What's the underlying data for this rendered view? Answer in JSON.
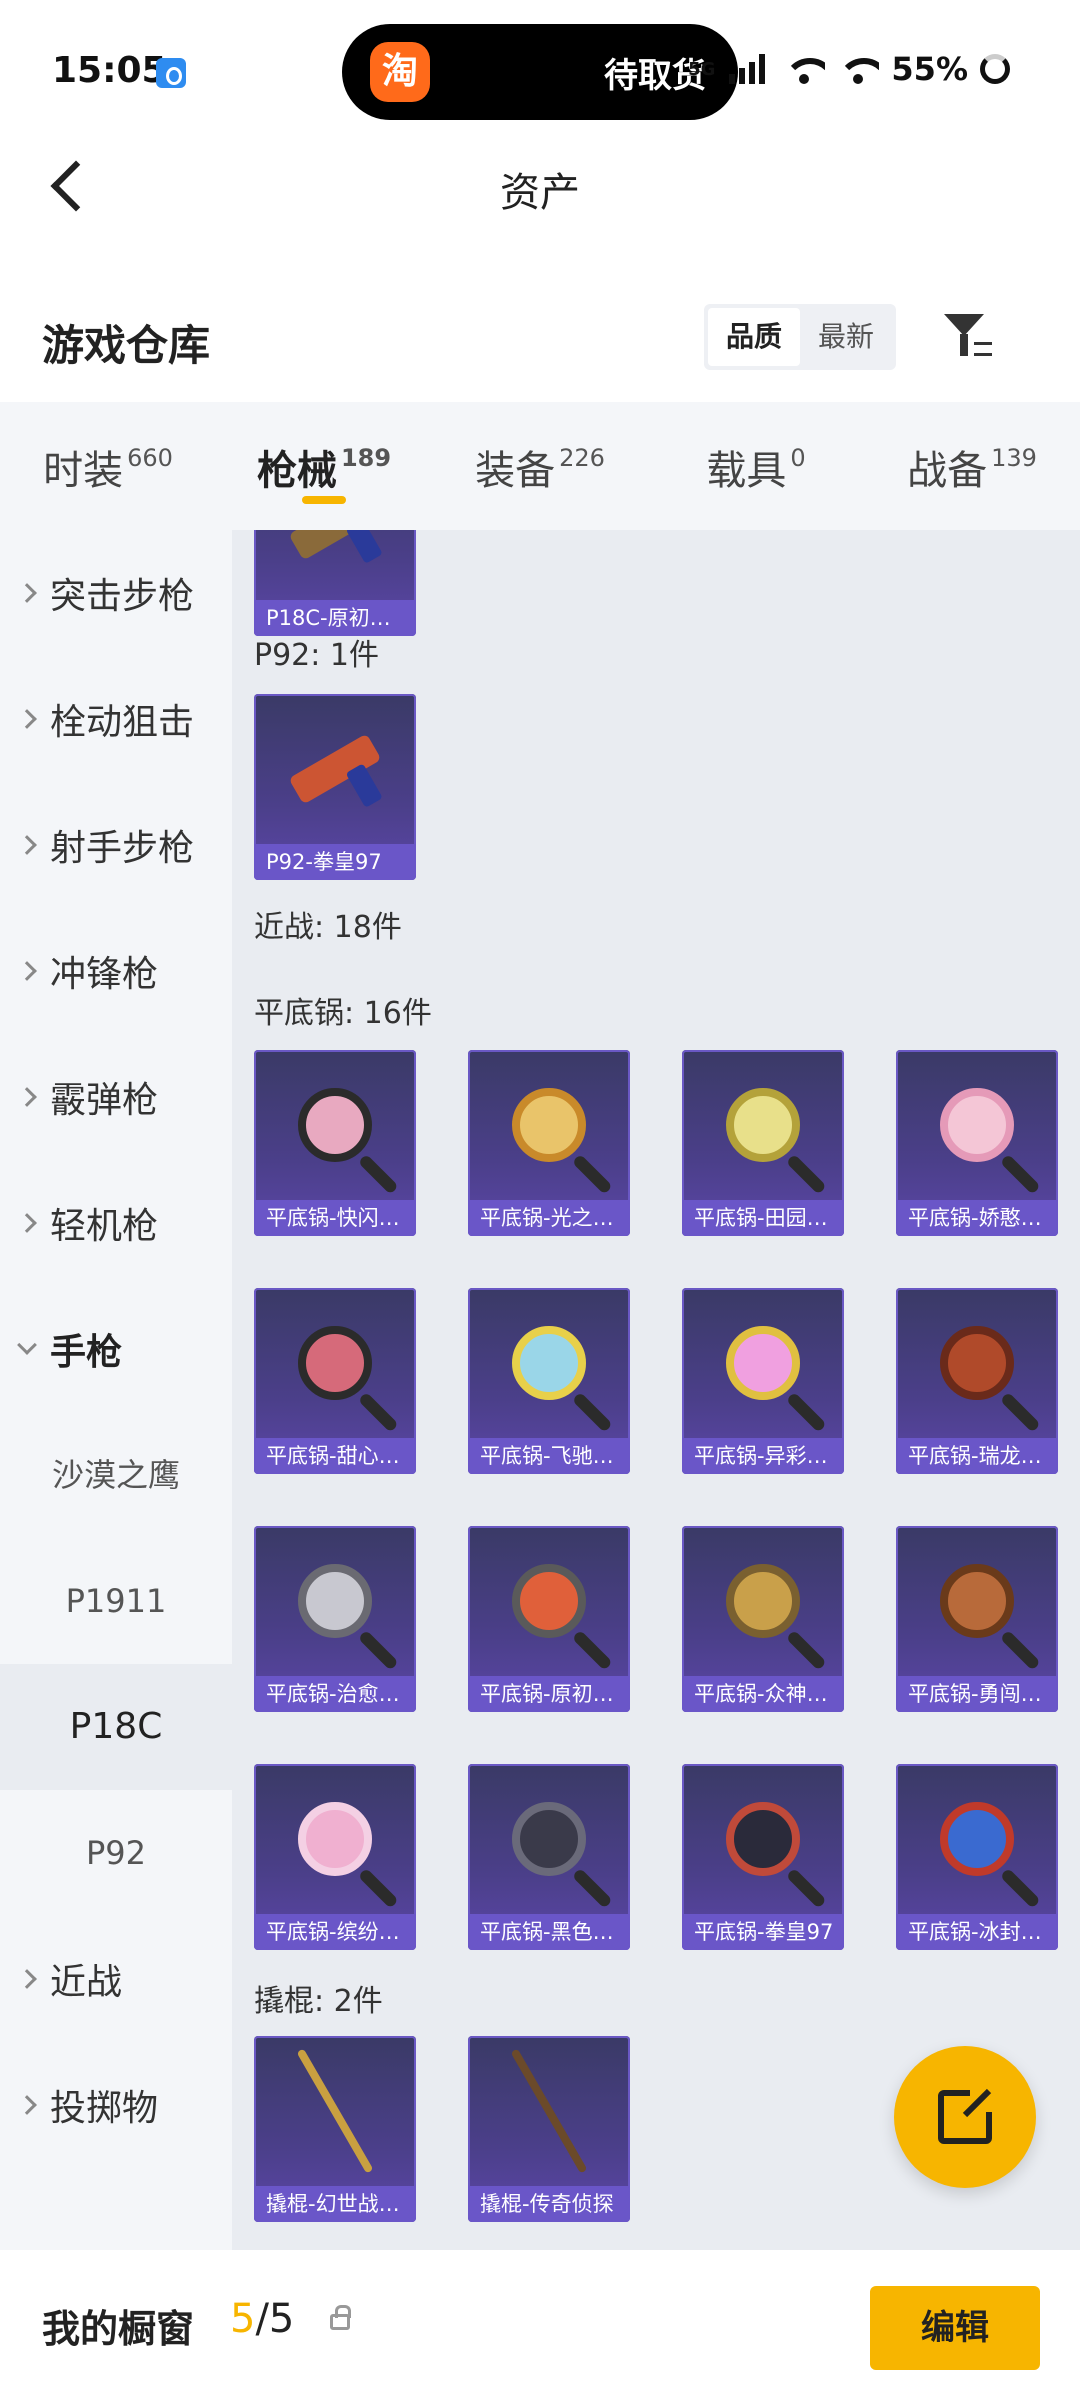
{
  "status_bar": {
    "time": "15:05",
    "pill_app_glyph": "淘",
    "pill_text": "待取货",
    "battery": "55%",
    "signal": "5G"
  },
  "header": {
    "title": "资产"
  },
  "warehouse": {
    "title": "游戏仓库",
    "sort_options": [
      "品质",
      "最新"
    ]
  },
  "tabs": [
    {
      "label": "时装",
      "count": "660"
    },
    {
      "label": "枪械",
      "count": "189"
    },
    {
      "label": "装备",
      "count": "226"
    },
    {
      "label": "载具",
      "count": "0"
    },
    {
      "label": "战备",
      "count": "139"
    }
  ],
  "sidebar": {
    "items": [
      "突击步枪",
      "栓动狙击",
      "射手步枪",
      "冲锋枪",
      "霰弹枪",
      "轻机枪",
      "手枪"
    ],
    "pistol_subs": [
      "沙漠之鹰",
      "P1911",
      "P18C",
      "P92"
    ],
    "after_items": [
      "近战",
      "投掷物"
    ]
  },
  "content": {
    "top_card_label": "P18C-原初…",
    "p92_header": "P92: 1件",
    "p92_card_label": "P92-拳皇97",
    "melee_header": "近战: 18件",
    "pan_header": "平底锅: 16件",
    "pan_cards": [
      "平底锅-快闪…",
      "平底锅-光之…",
      "平底锅-田园…",
      "平底锅-娇憨…",
      "平底锅-甜心…",
      "平底锅-飞驰…",
      "平底锅-异彩…",
      "平底锅-瑞龙…",
      "平底锅-治愈…",
      "平底锅-原初…",
      "平底锅-众神…",
      "平底锅-勇闯…",
      "平底锅-缤纷…",
      "平底锅-黑色…",
      "平底锅-拳皇97",
      "平底锅-冰封…"
    ],
    "crowbar_header": "撬棍: 2件",
    "crowbar_cards": [
      "撬棍-幻世战…",
      "撬棍-传奇侦探"
    ]
  },
  "bottom_bar": {
    "label": "我的橱窗",
    "count_highlight": "5",
    "count_rest": "/5",
    "edit_label": "编辑"
  },
  "colors": {
    "accent": "#f7b500",
    "card_label": "#6a56c8",
    "content_bg": "#e9ecf1"
  }
}
